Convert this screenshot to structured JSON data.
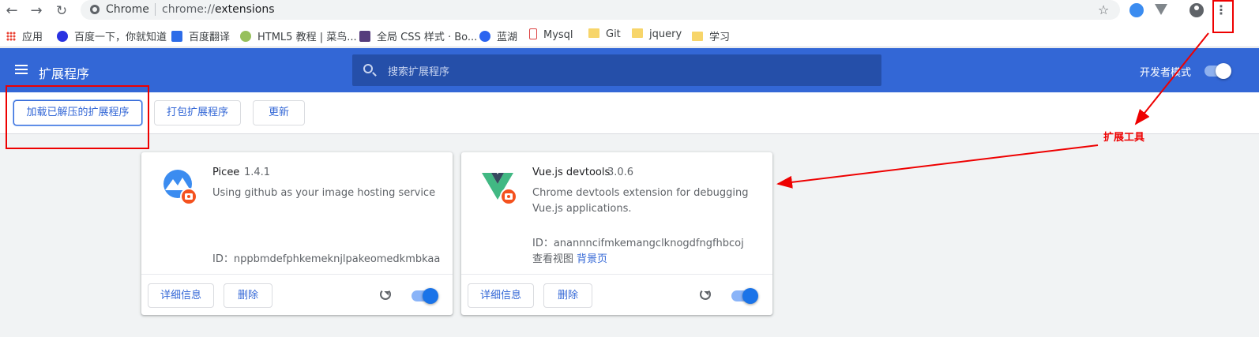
{
  "browser": {
    "site_name": "Chrome",
    "url_scheme": "chrome://",
    "url_host": "extensions"
  },
  "bookmarks": [
    {
      "label": "应用",
      "icon": "apps-grid-icon"
    },
    {
      "label": "百度一下，你就知道",
      "icon": "baidu-paw-icon",
      "color": "#2932e1"
    },
    {
      "label": "百度翻译",
      "icon": "baidu-translate-icon",
      "color": "#2d6ce8"
    },
    {
      "label": "HTML5 教程 | 菜鸟...",
      "icon": "runoob-icon",
      "color": "#97c05c"
    },
    {
      "label": "全局 CSS 样式 · Bo...",
      "icon": "bootstrap-icon",
      "color": "#563d7c"
    },
    {
      "label": "蓝湖",
      "icon": "lanhu-icon",
      "color": "#2b64f0"
    },
    {
      "label": "Mysql",
      "icon": "mysql-icon",
      "color": "#d44"
    },
    {
      "label": "Git",
      "icon": "folder-icon"
    },
    {
      "label": "jquery",
      "icon": "folder-icon"
    },
    {
      "label": "学习",
      "icon": "folder-icon"
    }
  ],
  "header": {
    "title": "扩展程序",
    "search_placeholder": "搜索扩展程序",
    "dev_mode_label": "开发者模式",
    "dev_mode_on": true,
    "accent_color": "#3367d6"
  },
  "toolbar": {
    "load_unpacked": "加载已解压的扩展程序",
    "pack_extension": "打包扩展程序",
    "update": "更新"
  },
  "extensions": [
    {
      "name": "Picee",
      "version": "1.4.1",
      "description": "Using github as your image hosting service",
      "id_text": "ID：nppbmdefphkemeknjlpakeomedkmbkaa",
      "details_label": "详细信息",
      "remove_label": "删除",
      "enabled": true
    },
    {
      "name": "Vue.js devtools",
      "version": "3.0.6",
      "description": "Chrome devtools extension for debugging Vue.js applications.",
      "id_text": "ID：anannncifmkemangclknogdfngfhbcoj",
      "inspect_label": "查看视图",
      "background_link": "背景页",
      "details_label": "详细信息",
      "remove_label": "删除",
      "enabled": true
    }
  ],
  "annotation": {
    "label": "扩展工具",
    "color": "#ee0000"
  }
}
